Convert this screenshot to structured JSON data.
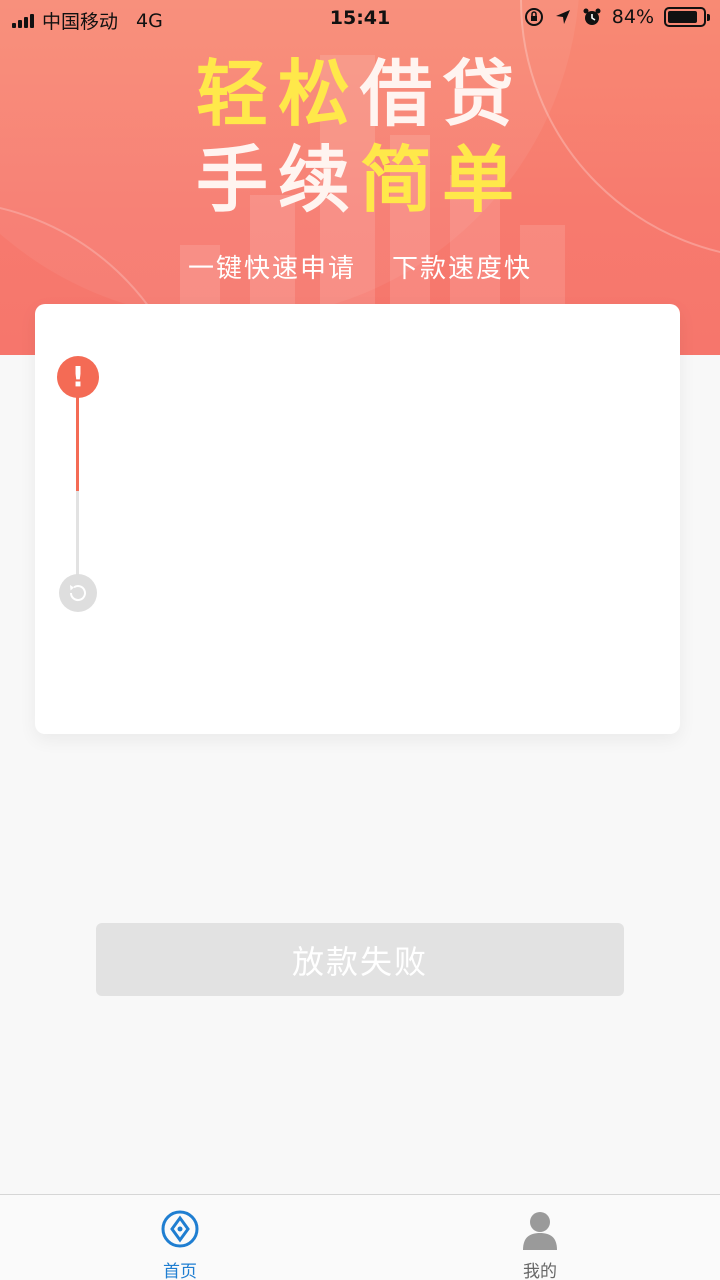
{
  "status_bar": {
    "carrier": "中国移动",
    "network": "4G",
    "time": "15:41",
    "battery_percent": "84%",
    "battery_level": 0.84
  },
  "banner": {
    "headline_line1": [
      "轻",
      "松",
      "借",
      "贷"
    ],
    "headline_line2": [
      "手",
      "续",
      "简",
      "单"
    ],
    "tagline_left": "一键快速申请",
    "tagline_right": "下款速度快",
    "colors": {
      "highlight": "#ffe84a",
      "background": "#f77a6e"
    }
  },
  "progress": {
    "steps": [
      {
        "state": "error",
        "icon": "exclamation-icon",
        "color": "#f46b55"
      },
      {
        "state": "pending",
        "icon": "refresh-icon",
        "color": "#dedede"
      }
    ]
  },
  "action_button": {
    "label": "放款失败",
    "enabled": false
  },
  "tab_bar": {
    "items": [
      {
        "label": "首页",
        "icon": "home-diamond-icon",
        "active": true,
        "color": "#1f7ed1"
      },
      {
        "label": "我的",
        "icon": "user-icon",
        "active": false,
        "color": "#999999"
      }
    ]
  }
}
